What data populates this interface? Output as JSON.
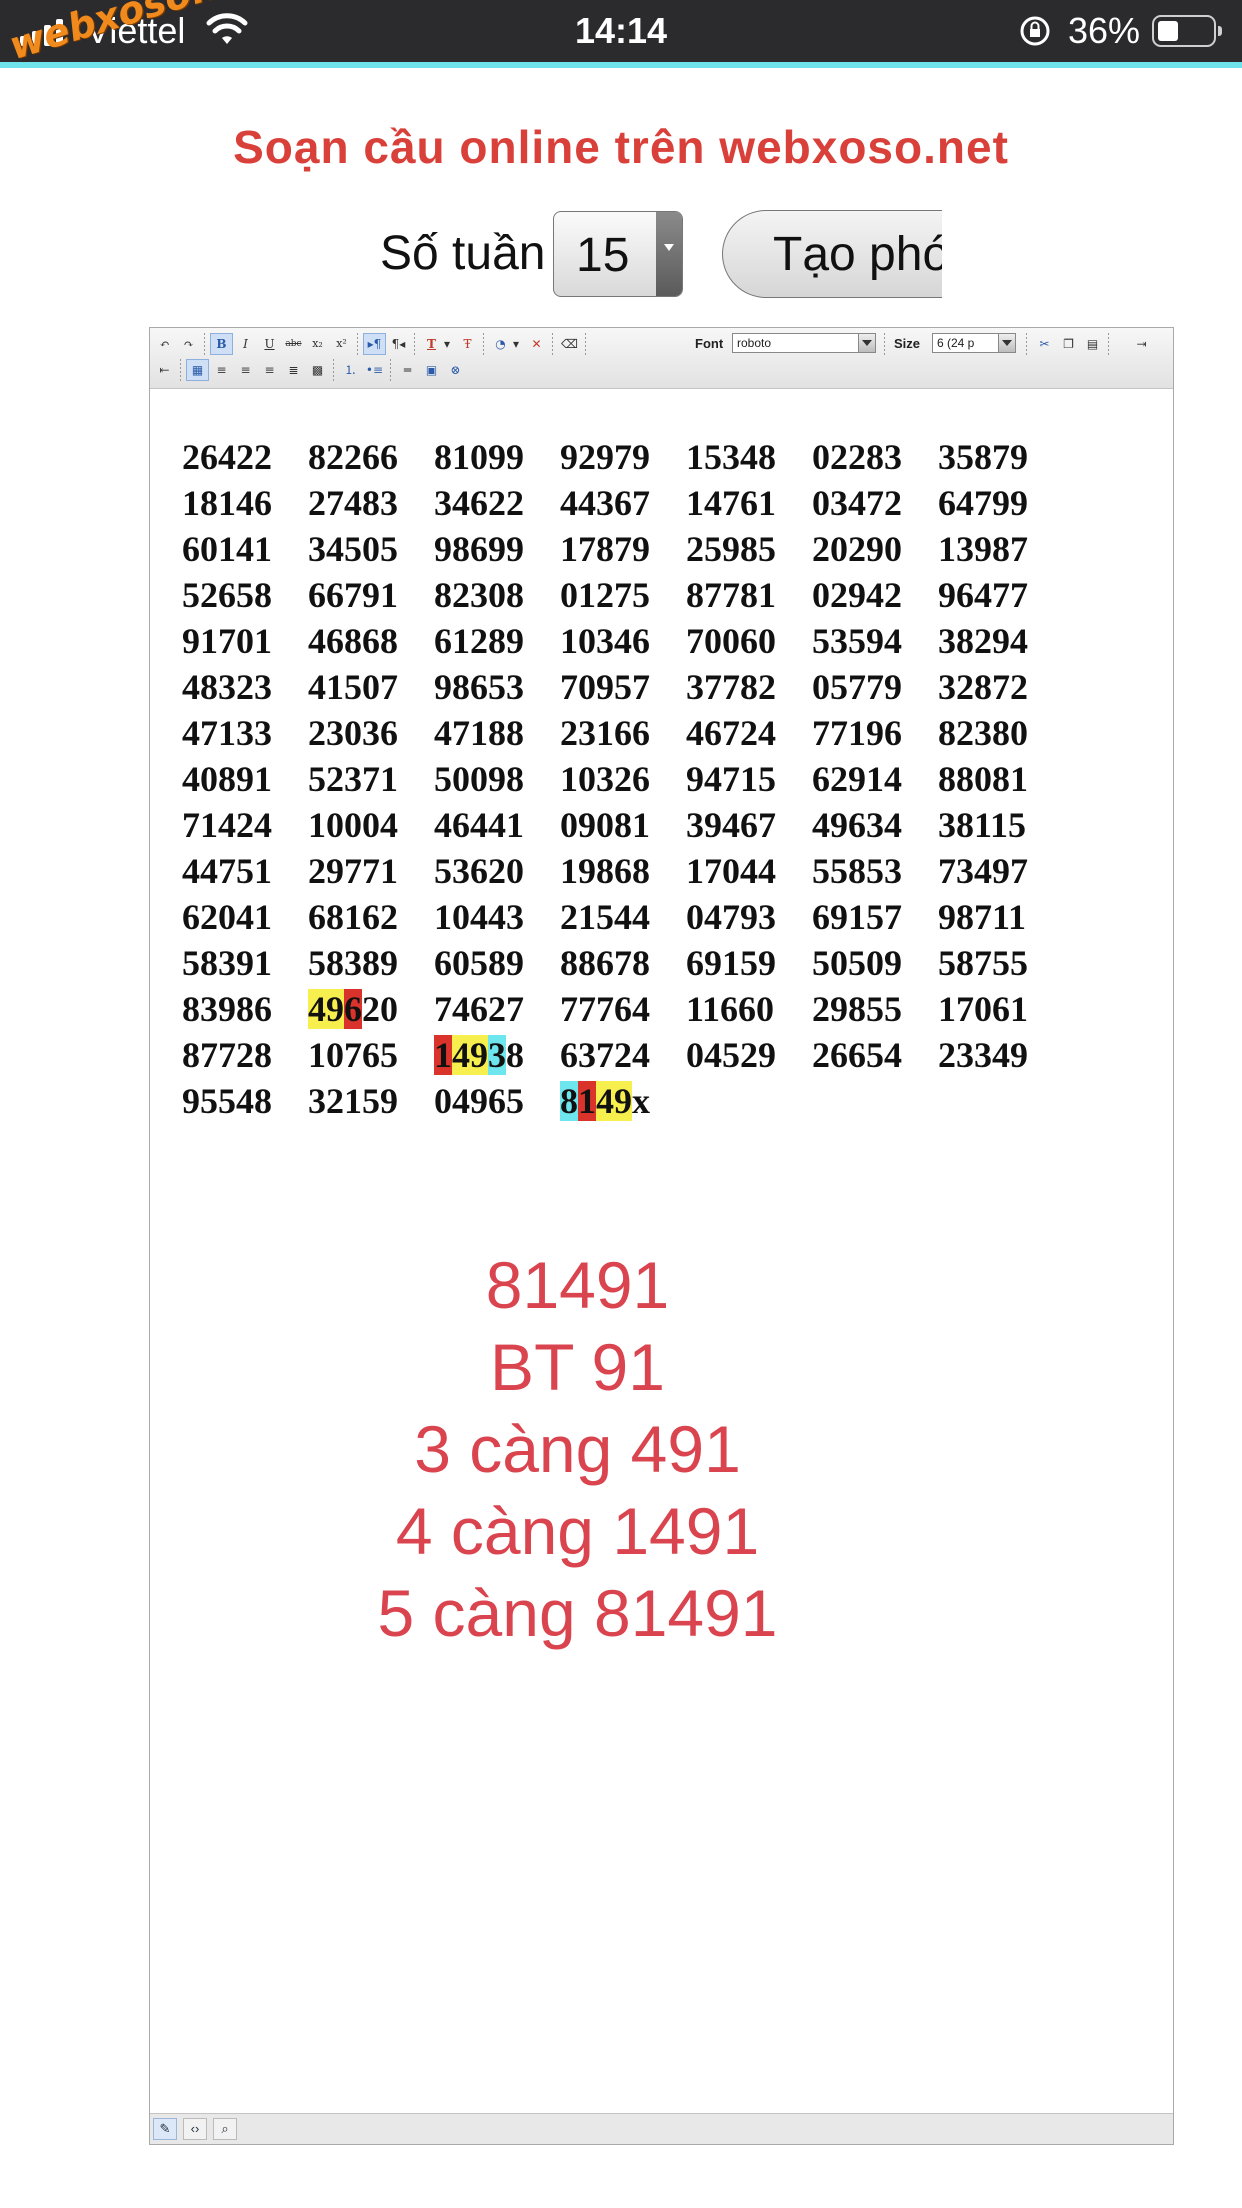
{
  "status_bar": {
    "carrier": "Viettel",
    "time": "14:14",
    "battery_percent": "36%",
    "watermark": "webxoso.net"
  },
  "header": {
    "title": "Soạn cầu online trên webxoso.net",
    "weeks_label": "Số tuần",
    "weeks_value": "15",
    "create_button": "Tạo phó"
  },
  "toolbar": {
    "font_label": "Font",
    "font_value": "roboto",
    "size_label": "Size",
    "size_value": "6 (24 p"
  },
  "grid": [
    [
      [
        "26422"
      ],
      [
        "82266"
      ],
      [
        "81099"
      ],
      [
        "92979"
      ],
      [
        "15348"
      ],
      [
        "02283"
      ],
      [
        "35879"
      ]
    ],
    [
      [
        "18146"
      ],
      [
        "27483"
      ],
      [
        "34622"
      ],
      [
        "44367"
      ],
      [
        "14761"
      ],
      [
        "03472"
      ],
      [
        "64799"
      ]
    ],
    [
      [
        "60141"
      ],
      [
        "34505"
      ],
      [
        "98699"
      ],
      [
        "17879"
      ],
      [
        "25985"
      ],
      [
        "20290"
      ],
      [
        "13987"
      ]
    ],
    [
      [
        "52658"
      ],
      [
        "66791"
      ],
      [
        "82308"
      ],
      [
        "01275"
      ],
      [
        "87781"
      ],
      [
        "02942"
      ],
      [
        "96477"
      ]
    ],
    [
      [
        "91701"
      ],
      [
        "46868"
      ],
      [
        "61289"
      ],
      [
        "10346"
      ],
      [
        "70060"
      ],
      [
        "53594"
      ],
      [
        "38294"
      ]
    ],
    [
      [
        "48323"
      ],
      [
        "41507"
      ],
      [
        "98653"
      ],
      [
        "70957"
      ],
      [
        "37782"
      ],
      [
        "05779"
      ],
      [
        "32872"
      ]
    ],
    [
      [
        "47133"
      ],
      [
        "23036"
      ],
      [
        "47188"
      ],
      [
        "23166"
      ],
      [
        "46724"
      ],
      [
        "77196"
      ],
      [
        "82380"
      ]
    ],
    [
      [
        "40891"
      ],
      [
        "52371"
      ],
      [
        "50098"
      ],
      [
        "10326"
      ],
      [
        "94715"
      ],
      [
        "62914"
      ],
      [
        "88081"
      ]
    ],
    [
      [
        "71424"
      ],
      [
        "10004"
      ],
      [
        "46441"
      ],
      [
        "09081"
      ],
      [
        "39467"
      ],
      [
        "49634"
      ],
      [
        "38115"
      ]
    ],
    [
      [
        "44751"
      ],
      [
        "29771"
      ],
      [
        "53620"
      ],
      [
        "19868"
      ],
      [
        "17044"
      ],
      [
        "55853"
      ],
      [
        "73497"
      ]
    ],
    [
      [
        "62041"
      ],
      [
        "68162"
      ],
      [
        "10443"
      ],
      [
        "21544"
      ],
      [
        "04793"
      ],
      [
        "69157"
      ],
      [
        "98711"
      ]
    ],
    [
      [
        "58391"
      ],
      [
        "58389"
      ],
      [
        "60589"
      ],
      [
        "88678"
      ],
      [
        "69159"
      ],
      [
        "50509"
      ],
      [
        "58755"
      ]
    ],
    [
      [
        "83986"
      ],
      [
        [
          "49",
          "y"
        ],
        [
          "6",
          "r"
        ],
        [
          "20",
          ""
        ]
      ],
      [
        "74627"
      ],
      [
        "77764"
      ],
      [
        "11660"
      ],
      [
        "29855"
      ],
      [
        "17061"
      ]
    ],
    [
      [
        "87728"
      ],
      [
        "10765"
      ],
      [
        [
          "1",
          "r"
        ],
        [
          "49",
          "y"
        ],
        [
          "3",
          "c"
        ],
        [
          "8",
          ""
        ]
      ],
      [
        "63724"
      ],
      [
        "04529"
      ],
      [
        "26654"
      ],
      [
        "23349"
      ]
    ],
    [
      [
        "95548"
      ],
      [
        "32159"
      ],
      [
        "04965"
      ],
      [
        [
          "8",
          "c"
        ],
        [
          "1",
          "r"
        ],
        [
          "49",
          "y"
        ],
        [
          "x",
          ""
        ]
      ]
    ]
  ],
  "results": {
    "line1": "81491",
    "line2": "BT 91",
    "line3": "3 càng 491",
    "line4": "4 càng 1491",
    "line5": "5 càng 81491"
  },
  "colors": {
    "title_red": "#d9403a",
    "result_red": "#d9444e",
    "highlight_yellow": "#f7ef4d",
    "highlight_red": "#d9332b",
    "highlight_cyan": "#6ee6ee",
    "status_accent": "#6fe3ec"
  }
}
